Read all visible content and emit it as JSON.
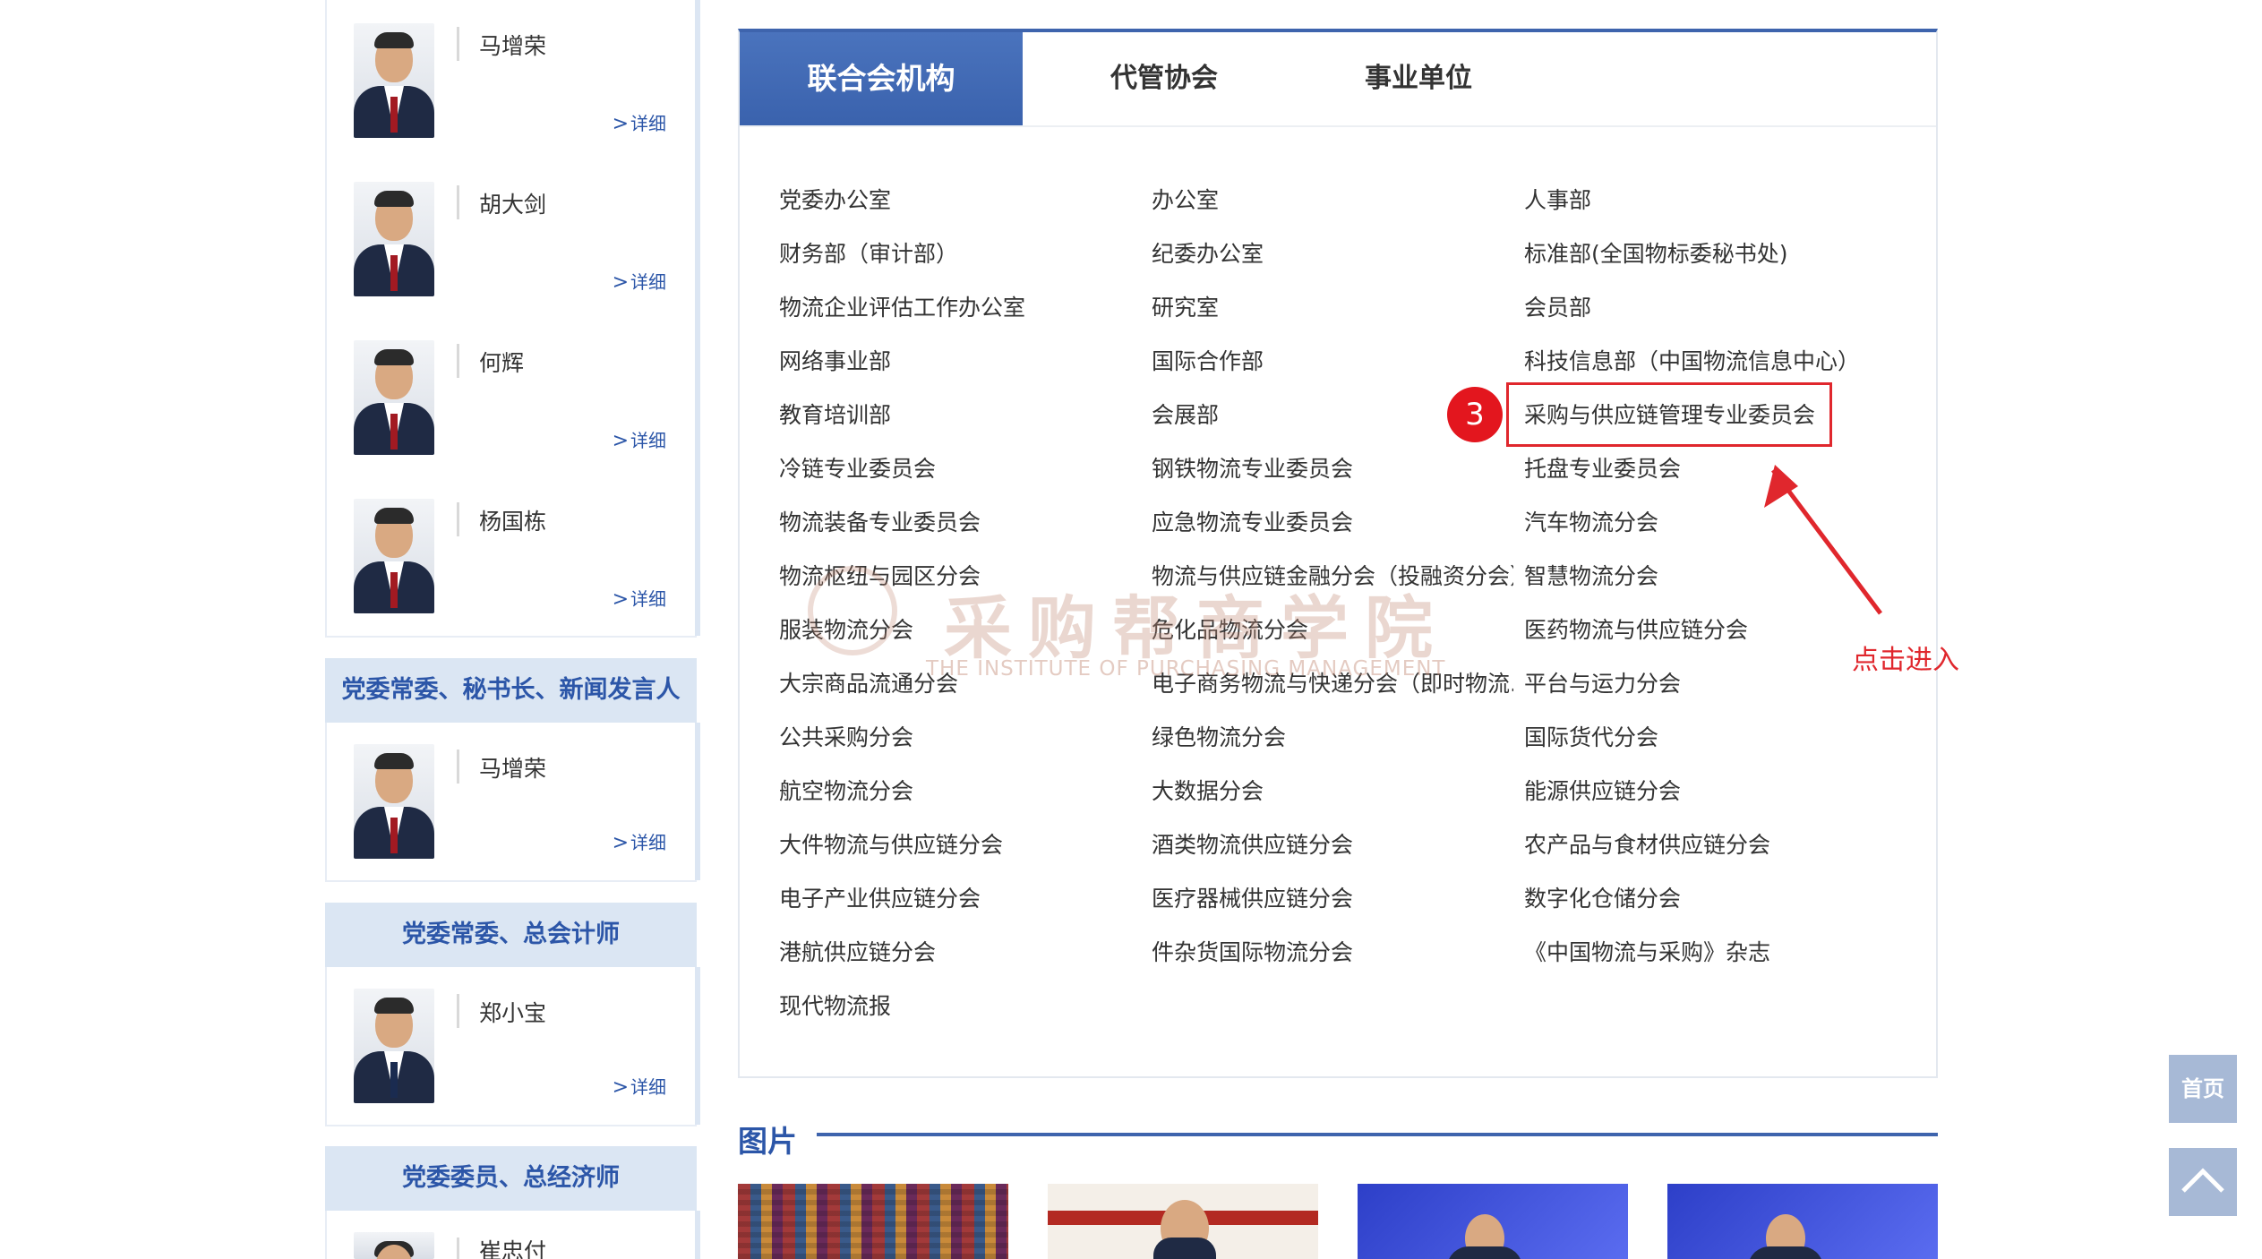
{
  "leaders_top": [
    {
      "name": "马增荣",
      "detail": "详细"
    },
    {
      "name": "胡大剑",
      "detail": "详细"
    },
    {
      "name": "何辉",
      "detail": "详细"
    },
    {
      "name": "杨国栋",
      "detail": "详细"
    }
  ],
  "section2": {
    "title": "党委常委、秘书长、新闻发言人",
    "person": {
      "name": "马增荣",
      "detail": "详细"
    }
  },
  "section3": {
    "title": "党委常委、总会计师",
    "person": {
      "name": "郑小宝",
      "detail": "详细"
    }
  },
  "section4": {
    "title": "党委委员、总经济师",
    "person": {
      "name": "崔忠付"
    }
  },
  "tabs": [
    "联合会机构",
    "代管协会",
    "事业单位"
  ],
  "columns": [
    [
      "党委办公室",
      "财务部（审计部）",
      "物流企业评估工作办公室",
      "网络事业部",
      "教育培训部",
      "冷链专业委员会",
      "物流装备专业委员会",
      "物流枢纽与园区分会",
      "服装物流分会",
      "大宗商品流通分会",
      "公共采购分会",
      "航空物流分会",
      "大件物流与供应链分会",
      "电子产业供应链分会",
      "港航供应链分会",
      "现代物流报"
    ],
    [
      "办公室",
      "纪委办公室",
      "研究室",
      "国际合作部",
      "会展部",
      "钢铁物流专业委员会",
      "应急物流专业委员会",
      "物流与供应链金融分会（投融资分会）",
      "危化品物流分会",
      "电子商务物流与快递分会（即时物流...",
      "绿色物流分会",
      "大数据分会",
      "酒类物流供应链分会",
      "医疗器械供应链分会",
      "件杂货国际物流分会"
    ],
    [
      "人事部",
      "标准部(全国物标委秘书处)",
      "会员部",
      "科技信息部（中国物流信息中心）",
      "采购与供应链管理专业委员会",
      "托盘专业委员会",
      "汽车物流分会",
      "智慧物流分会",
      "医药物流与供应链分会",
      "平台与运力分会",
      "国际货代分会",
      "能源供应链分会",
      "农产品与食材供应链分会",
      "数字化仓储分会",
      "《中国物流与采购》杂志"
    ]
  ],
  "annotation": {
    "step": "3",
    "text": "点击进入",
    "color": "#e0272d"
  },
  "watermark": {
    "cn": "采购帮商学院",
    "en": "THE INSTITUTE OF PURCHASING MANAGEMENT"
  },
  "images_section": {
    "title": "图片"
  },
  "side_buttons": {
    "home": "首页"
  },
  "colors": {
    "primary": "#3e64ad",
    "head_bg": "#dbe6f3",
    "accent_red": "#e0272d"
  }
}
